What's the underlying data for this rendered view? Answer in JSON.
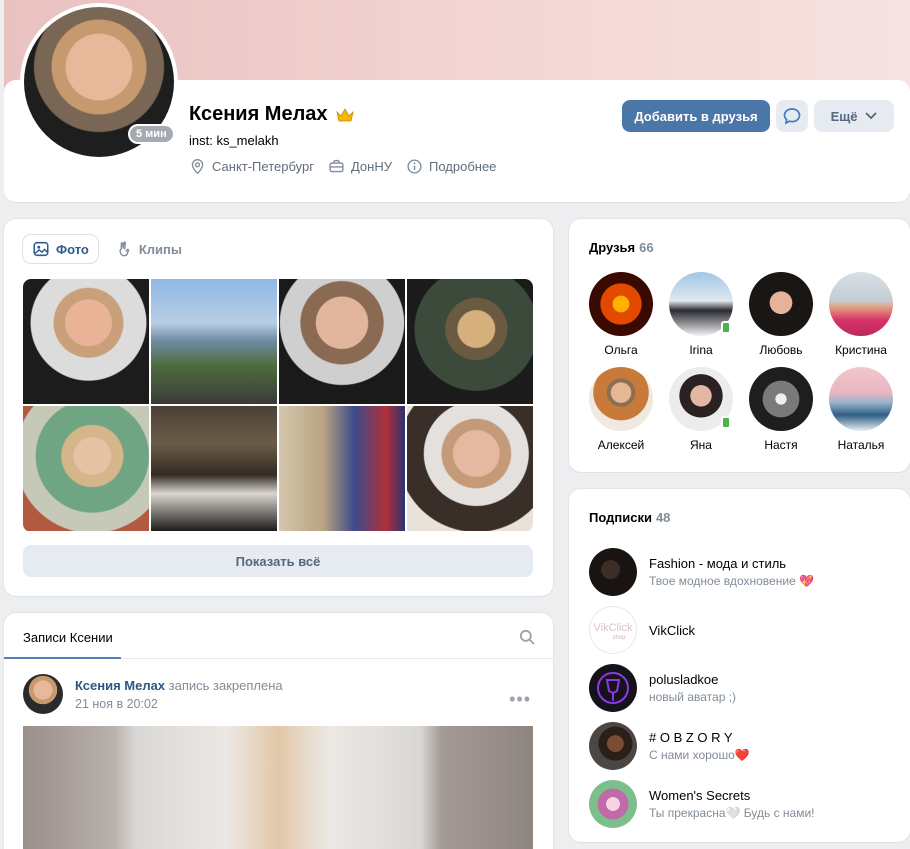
{
  "profile": {
    "name": "Ксения Мелах",
    "status": "inst: ks_melakh",
    "online": "5 мин",
    "city": "Санкт-Петербург",
    "university": "ДонНУ",
    "more_info": "Подробнее"
  },
  "actions": {
    "add_friend": "Добавить в друзья",
    "more": "Ещё"
  },
  "photos": {
    "tab_photos": "Фото",
    "tab_clips": "Клипы",
    "show_all": "Показать всё"
  },
  "posts": {
    "tab": "Записи Ксении",
    "author": "Ксения Мелах",
    "pinned": "запись закреплена",
    "date": "21 ноя в 20:02"
  },
  "friends": {
    "title": "Друзья",
    "count": "66",
    "items": [
      {
        "name": "Ольга"
      },
      {
        "name": "Irina"
      },
      {
        "name": "Любовь"
      },
      {
        "name": "Кристина"
      },
      {
        "name": "Алексей"
      },
      {
        "name": "Яна"
      },
      {
        "name": "Настя"
      },
      {
        "name": "Наталья"
      }
    ]
  },
  "subscriptions": {
    "title": "Подписки",
    "count": "48",
    "items": [
      {
        "name": "Fashion - мода и стиль",
        "desc": "Твое модное вдохновение 💖"
      },
      {
        "name": "VikClick",
        "desc": ""
      },
      {
        "name": "polusladkoe",
        "desc": "новый аватар ;)"
      },
      {
        "name": "# O B Z O R Y",
        "desc": "С нами хорошо❤️"
      },
      {
        "name": "Women's Secrets",
        "desc": "Ты прекрасна🤍 Будь с нами!"
      }
    ]
  },
  "colors": {
    "accent": "#4a76a8",
    "link": "#2a5885",
    "muted": "#818c99",
    "online": "#4bb34b"
  }
}
